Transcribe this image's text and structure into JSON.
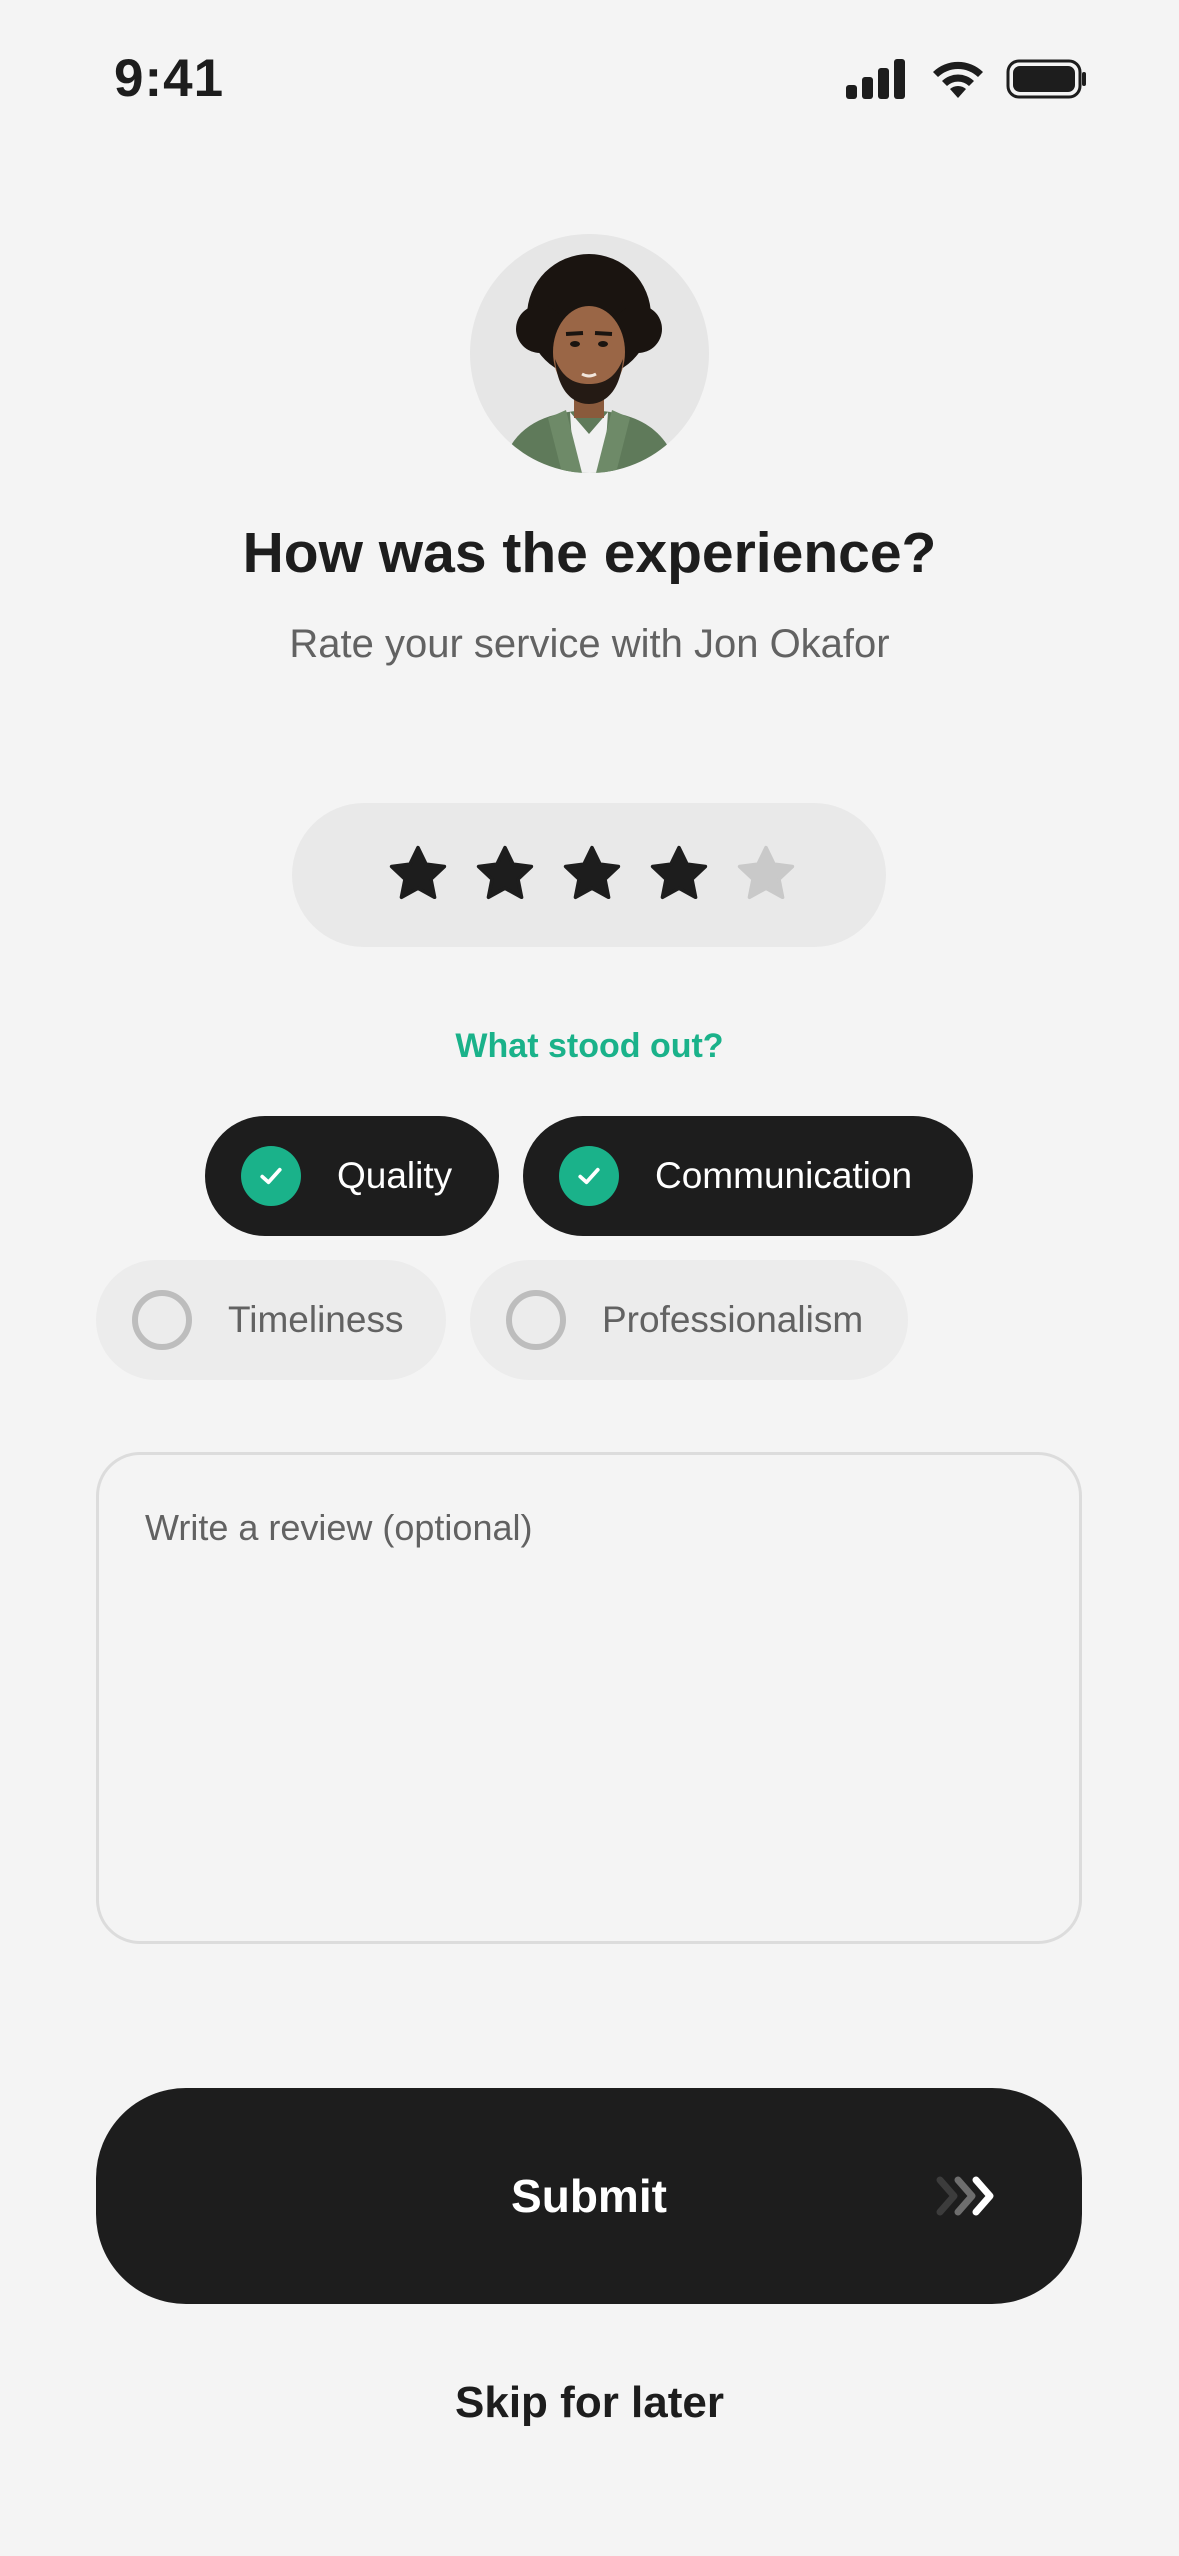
{
  "status_bar": {
    "time": "9:41",
    "icons": [
      "signal-icon",
      "wifi-icon",
      "battery-icon"
    ]
  },
  "profile": {
    "avatar_icon": "person-avatar"
  },
  "header": {
    "title": "How was the experience?",
    "subtitle": "Rate your service with Jon Okafor"
  },
  "rating": {
    "value": 4,
    "max": 5,
    "filled_color": "#1d1d1d",
    "empty_color": "#c9c9c9"
  },
  "highlights": {
    "label": "What stood out?",
    "options": [
      {
        "label": "Quality",
        "selected": true
      },
      {
        "label": "Communication",
        "selected": true
      },
      {
        "label": "Timeliness",
        "selected": false
      },
      {
        "label": "Professionalism",
        "selected": false
      }
    ]
  },
  "review": {
    "placeholder": "Write a review (optional)",
    "value": ""
  },
  "actions": {
    "submit_label": "Submit",
    "skip_label": "Skip for later"
  },
  "colors": {
    "accent": "#1ab28a",
    "dark": "#1d1d1d",
    "background": "#f4f4f4"
  }
}
